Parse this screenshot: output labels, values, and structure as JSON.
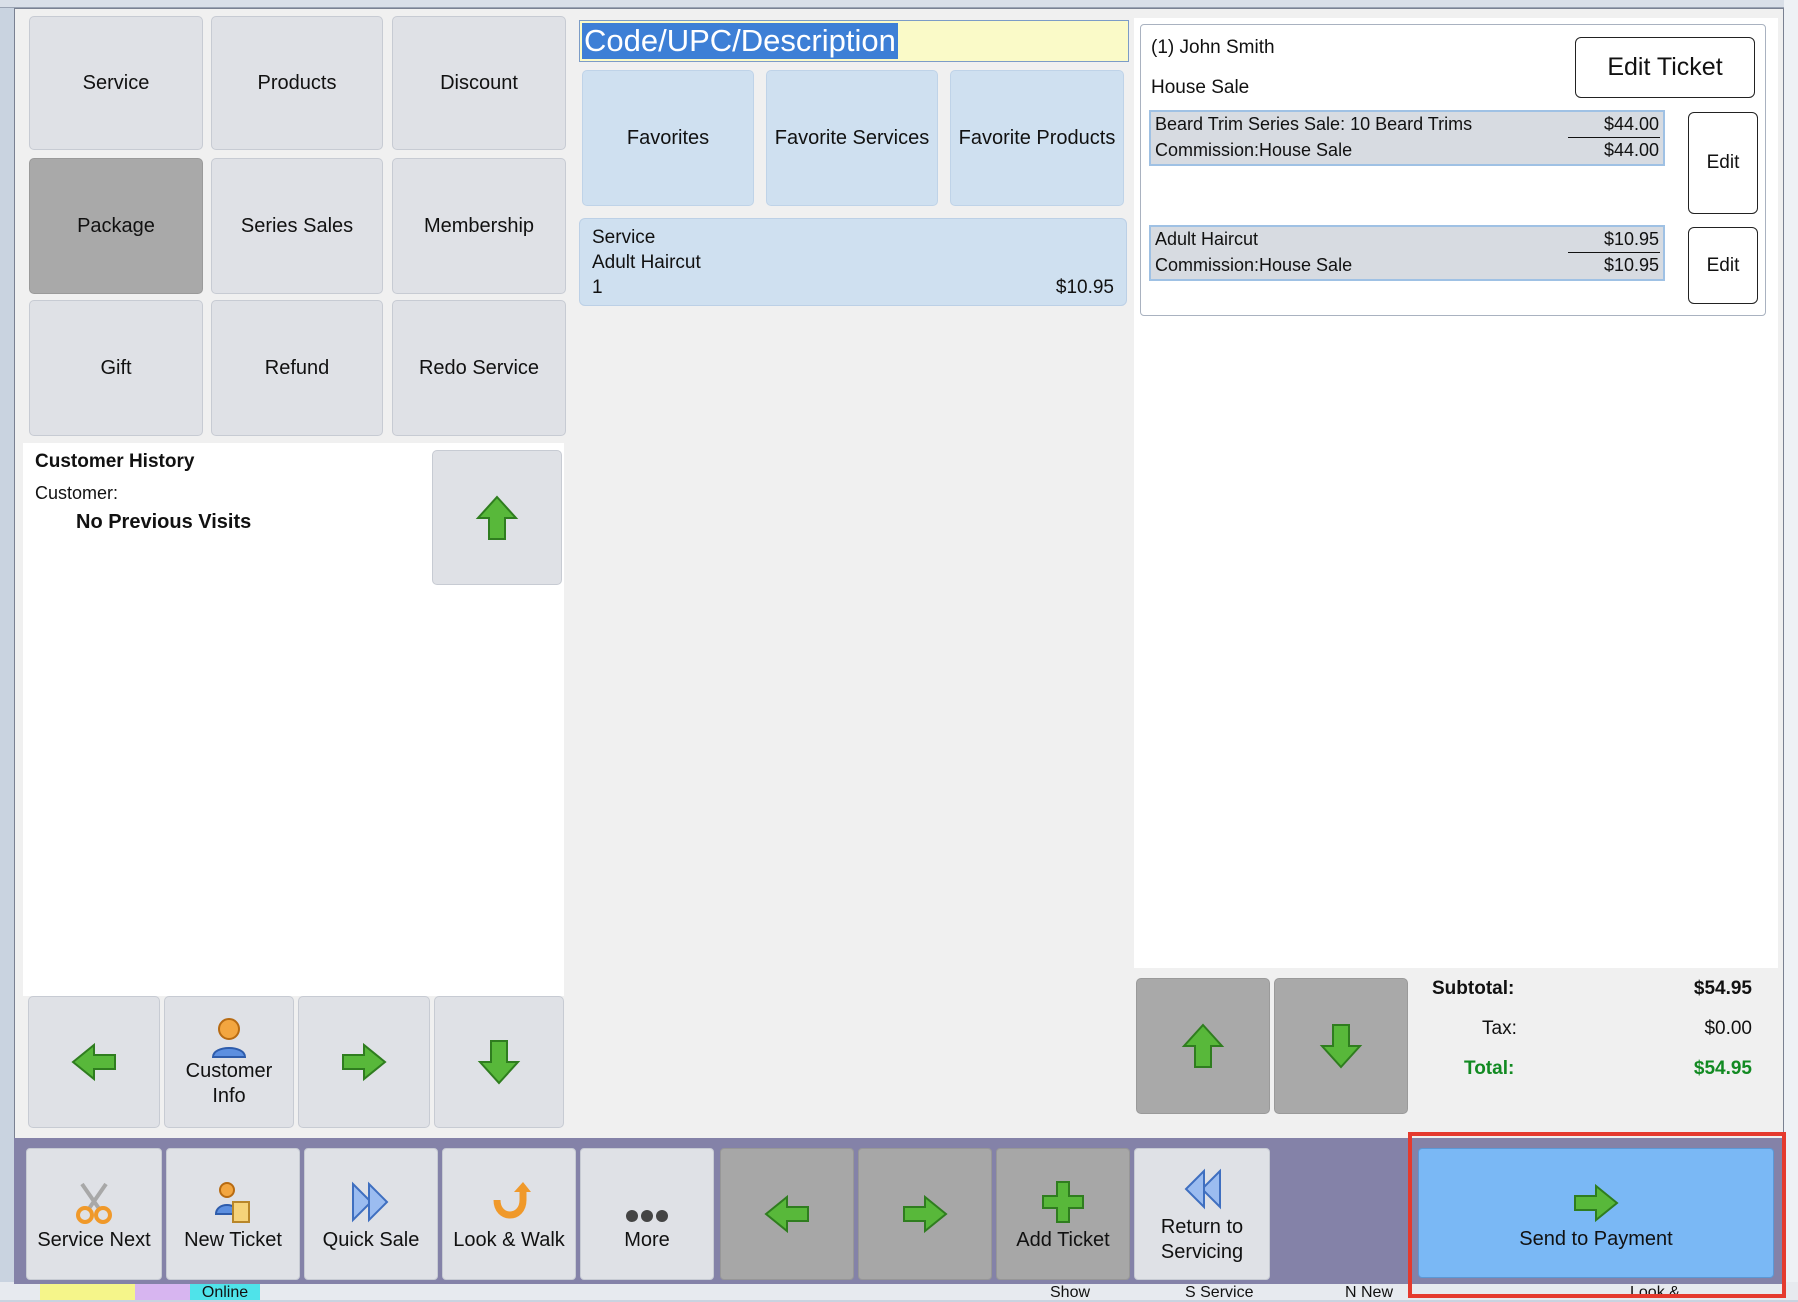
{
  "category_buttons": [
    "Service",
    "Products",
    "Discount",
    "Package",
    "Series Sales",
    "Membership",
    "Gift",
    "Refund",
    "Redo Service"
  ],
  "search": {
    "value": "Code/UPC/Description"
  },
  "favorites_buttons": [
    "Favorites",
    "Favorite Services",
    "Favorite Products"
  ],
  "service_item": {
    "type": "Service",
    "name": "Adult Haircut",
    "qty": "1",
    "price": "$10.95"
  },
  "customer_history": {
    "title": "Customer History",
    "customer_label": "Customer:",
    "no_visits": "No Previous Visits"
  },
  "left_nav": {
    "customer_info_line1": "Customer",
    "customer_info_line2": "Info"
  },
  "ticket": {
    "customer": "(1) John Smith",
    "sale_type": "House Sale",
    "edit_ticket_label": "Edit Ticket",
    "lines": [
      {
        "desc": "Beard Trim Series Sale: 10 Beard Trims",
        "price": "$44.00",
        "commission": "Commission:House Sale",
        "commission_amount": "$44.00",
        "edit_label": "Edit"
      },
      {
        "desc": "Adult Haircut",
        "price": "$10.95",
        "commission": "Commission:House Sale",
        "commission_amount": "$10.95",
        "edit_label": "Edit"
      }
    ]
  },
  "totals": {
    "subtotal_label": "Subtotal:",
    "subtotal": "$54.95",
    "tax_label": "Tax:",
    "tax": "$0.00",
    "total_label": "Total:",
    "total": "$54.95"
  },
  "toolbar": {
    "service_next": "Service Next",
    "new_ticket": "New Ticket",
    "quick_sale": "Quick Sale",
    "look_walk": "Look & Walk",
    "more": "More",
    "add_ticket": "Add Ticket",
    "return_line1": "Return to",
    "return_line2": "Servicing",
    "send_to_payment": "Send to Payment"
  },
  "background": {
    "status_items": [
      "Online",
      "Show",
      "S Service",
      "N New",
      "Look &"
    ]
  },
  "colors": {
    "highlight": "#e53a2e",
    "payment_button": "#7ab8f5",
    "total_green": "#128a22",
    "arrow_green": "#58b83a",
    "toolbar_bg": "#8482a8"
  }
}
